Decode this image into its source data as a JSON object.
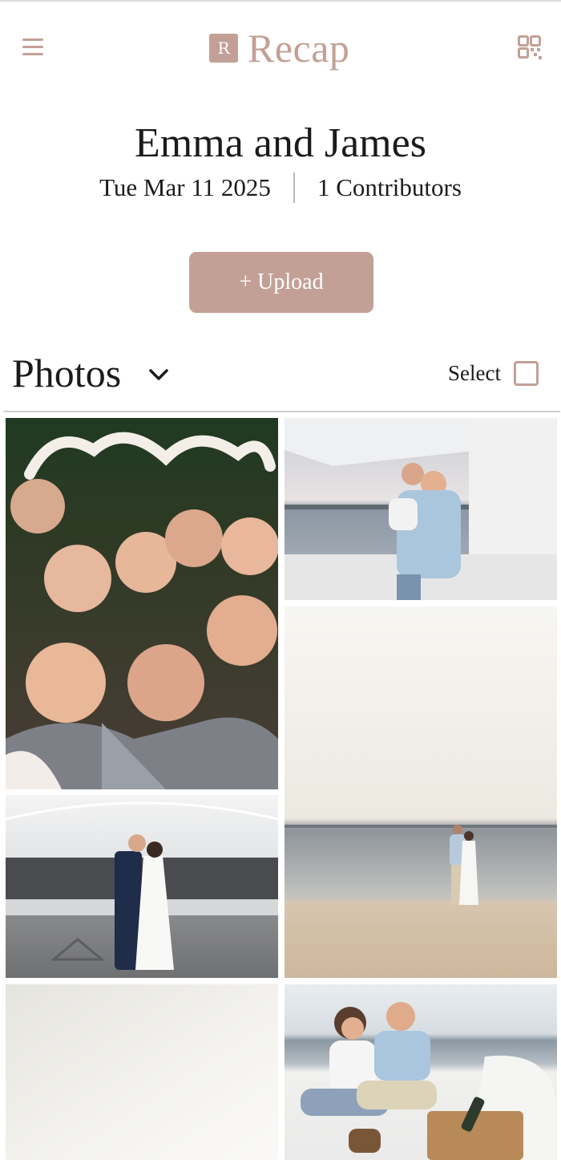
{
  "app": {
    "logo_letter": "R",
    "name": "Recap",
    "brand_color": "#c3a096"
  },
  "header": {
    "menu_icon": "hamburger-menu-icon",
    "qr_icon": "qr-code-icon"
  },
  "event": {
    "title": "Emma and James",
    "date": "Tue Mar 11 2025",
    "contributors": "1 Contributors"
  },
  "upload": {
    "label": "+ Upload"
  },
  "gallery": {
    "section_label": "Photos",
    "select_label": "Select",
    "photos": [
      {
        "name": "photo-booth-cheers"
      },
      {
        "name": "couple-on-boat"
      },
      {
        "name": "couple-on-beach"
      },
      {
        "name": "first-dance-tent"
      },
      {
        "name": "hazy-sky"
      },
      {
        "name": "couple-picnic-boat"
      }
    ]
  }
}
